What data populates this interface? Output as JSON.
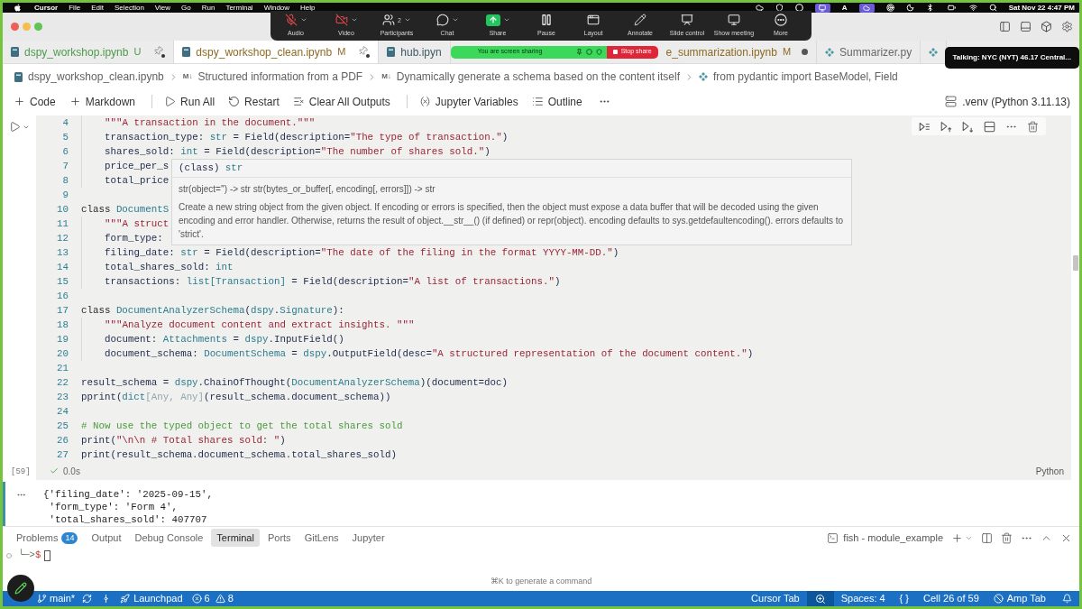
{
  "menu_bar": {
    "app": "Cursor",
    "menus": [
      "File",
      "Edit",
      "Selection",
      "View",
      "Go",
      "Run",
      "Terminal",
      "Window",
      "Help"
    ],
    "input_source": "A",
    "clock": "Sat Nov 22 4:47 PM"
  },
  "meeting_controls": [
    {
      "kind": "audio",
      "label": "Audio",
      "muted": true,
      "menu": true
    },
    {
      "kind": "video",
      "label": "Video",
      "muted": true,
      "menu": true
    },
    {
      "kind": "participants",
      "label": "Participants",
      "count": "2",
      "menu": true
    },
    {
      "kind": "chat",
      "label": "Chat",
      "menu": true
    },
    {
      "kind": "share",
      "label": "Share",
      "menu": true
    },
    {
      "kind": "pause",
      "label": "Pause",
      "menu": false
    },
    {
      "kind": "layout",
      "label": "Layout",
      "menu": false
    },
    {
      "kind": "annotate",
      "label": "Annotate",
      "menu": false
    },
    {
      "kind": "slides",
      "label": "Slide control",
      "menu": false
    },
    {
      "kind": "meeting",
      "label": "Show meeting",
      "menu": false
    },
    {
      "kind": "more",
      "label": "More",
      "menu": false
    }
  ],
  "sharing_banner": {
    "text": "You are screen sharing",
    "stop_label": "Stop share"
  },
  "speaker_notice": "Talking: NYC (NYT) 46.17 Central...",
  "tabs": [
    {
      "kind": "notebook",
      "label": "dspy_workshop.ipynb",
      "git": "U",
      "color": "#4d9a4b",
      "pinned": true,
      "dirty": false,
      "selected": false
    },
    {
      "kind": "notebook",
      "label": "dspy_workshop_clean.ipynb",
      "git": "M",
      "color": "#8e6b22",
      "pinned": true,
      "dirty": false,
      "selected": true
    },
    {
      "kind": "notebook",
      "label": "hub.ipyn",
      "color": "#3f5866",
      "pinned": false,
      "dirty": false,
      "selected": false
    },
    {
      "label": "e_summarization.ipynb",
      "git": "M",
      "color": "#8e6b22",
      "pinned": false,
      "dirty": true,
      "selected": false
    },
    {
      "kind": "python",
      "label": "Summarizer.py",
      "color": "#666666",
      "pinned": false,
      "dirty": false,
      "selected": false
    },
    {
      "kind": "python",
      "pinned": false,
      "dirty": false,
      "selected": false
    }
  ],
  "breadcrumb": [
    {
      "kind": "notebook",
      "text": "dspy_workshop_clean.ipynb"
    },
    {
      "kind": "markdown",
      "marker": "M↓",
      "text": "Structured information from a PDF"
    },
    {
      "kind": "markdown",
      "marker": "M↓",
      "text": "Dynamically generate a schema based on the content itself"
    },
    {
      "kind": "code",
      "text": "from pydantic import BaseModel, Field"
    }
  ],
  "notebook_toolbar": {
    "actions": [
      {
        "kind": "add",
        "label": "Code"
      },
      {
        "kind": "add",
        "label": "Markdown"
      },
      {
        "kind": "divider"
      },
      {
        "kind": "run",
        "label": "Run All"
      },
      {
        "kind": "restart",
        "label": "Restart"
      },
      {
        "kind": "clear",
        "label": "Clear All Outputs"
      },
      {
        "kind": "divider"
      },
      {
        "kind": "variables",
        "label": "Jupyter Variables"
      },
      {
        "kind": "outline",
        "label": "Outline"
      },
      {
        "kind": "more"
      }
    ],
    "kernel": ".venv (Python 3.11.13)"
  },
  "cell": {
    "lines": [
      {
        "children": [
          {
            "number": "4",
            "tokens": [
              {
                "kind": "string",
                "text": "\"\"\"A transaction in the document.\"\"\""
              }
            ]
          },
          {
            "number": "5",
            "tokens": [
              {
                "kind": "plain",
                "text": "transaction_type: "
              },
              {
                "kind": "type",
                "text": "str"
              },
              {
                "kind": "plain",
                "text": " = Field(description="
              },
              {
                "kind": "string",
                "text": "\"The type of transaction.\""
              },
              {
                "kind": "plain",
                "text": ")"
              }
            ]
          },
          {
            "number": "6",
            "tokens": [
              {
                "kind": "plain",
                "text": "shares_sold: "
              },
              {
                "kind": "type",
                "text": "int"
              },
              {
                "kind": "plain",
                "text": " = Field(description="
              },
              {
                "kind": "string",
                "text": "\"The number of shares sold.\""
              },
              {
                "kind": "plain",
                "text": ")"
              }
            ]
          },
          {
            "number": "7",
            "tokens": [
              {
                "kind": "plain",
                "text": "price_per_s"
              }
            ]
          },
          {
            "number": "8",
            "tokens": [
              {
                "kind": "plain",
                "text": "total_price"
              }
            ]
          }
        ]
      },
      {
        "number": "9"
      },
      {
        "number": "10",
        "tokens": [
          {
            "kind": "keyword",
            "text": "class "
          },
          {
            "kind": "type",
            "text": "DocumentS"
          }
        ],
        "children": [
          {
            "number": "11",
            "tokens": [
              {
                "kind": "string",
                "text": "\"\"\"A struct"
              }
            ]
          },
          {
            "number": "12",
            "tokens": [
              {
                "kind": "plain",
                "text": "form_type:"
              }
            ]
          },
          {
            "number": "13",
            "tokens": [
              {
                "kind": "plain",
                "text": "filing_date: "
              },
              {
                "kind": "type",
                "text": "str"
              },
              {
                "kind": "plain",
                "text": " = Field(description="
              },
              {
                "kind": "string",
                "text": "\"The date of the filing in the format YYYY-MM-DD.\""
              },
              {
                "kind": "plain",
                "text": ")"
              }
            ]
          },
          {
            "number": "14",
            "tokens": [
              {
                "kind": "plain",
                "text": "total_shares_sold: "
              },
              {
                "kind": "type",
                "text": "int"
              }
            ]
          },
          {
            "number": "15",
            "tokens": [
              {
                "kind": "plain",
                "text": "transactions: "
              },
              {
                "kind": "type",
                "text": "list[Transaction]"
              },
              {
                "kind": "plain",
                "text": " = Field(description="
              },
              {
                "kind": "string",
                "text": "\"A list of transactions.\""
              },
              {
                "kind": "plain",
                "text": ")"
              }
            ]
          }
        ]
      },
      {
        "number": "16"
      },
      {
        "number": "17",
        "tokens": [
          {
            "kind": "keyword",
            "text": "class "
          },
          {
            "kind": "type",
            "text": "DocumentAnalyzerSchema"
          },
          {
            "kind": "plain",
            "text": "("
          },
          {
            "kind": "type",
            "text": "dspy"
          },
          {
            "kind": "plain",
            "text": "."
          },
          {
            "kind": "type",
            "text": "Signature"
          },
          {
            "kind": "plain",
            "text": "):"
          }
        ],
        "children": [
          {
            "number": "18",
            "tokens": [
              {
                "kind": "string",
                "text": "\"\"\"Analyze document content and extract insights. \"\"\""
              }
            ]
          },
          {
            "number": "19",
            "tokens": [
              {
                "kind": "plain",
                "text": "document: "
              },
              {
                "kind": "type",
                "text": "Attachments"
              },
              {
                "kind": "plain",
                "text": " = "
              },
              {
                "kind": "type",
                "text": "dspy"
              },
              {
                "kind": "plain",
                "text": ".InputField()"
              }
            ]
          },
          {
            "number": "20",
            "tokens": [
              {
                "kind": "plain",
                "text": "document_schema: "
              },
              {
                "kind": "type",
                "text": "DocumentSchema"
              },
              {
                "kind": "plain",
                "text": " = "
              },
              {
                "kind": "type",
                "text": "dspy"
              },
              {
                "kind": "plain",
                "text": ".OutputField(desc="
              },
              {
                "kind": "string",
                "text": "\"A structured representation of the document content.\""
              },
              {
                "kind": "plain",
                "text": ")"
              }
            ]
          }
        ]
      },
      {
        "number": "21"
      },
      {
        "number": "22",
        "tokens": [
          {
            "kind": "plain",
            "text": "result_schema = "
          },
          {
            "kind": "type",
            "text": "dspy"
          },
          {
            "kind": "plain",
            "text": ".ChainOfThought("
          },
          {
            "kind": "type",
            "text": "DocumentAnalyzerSchema"
          },
          {
            "kind": "plain",
            "text": ")(document=doc)"
          }
        ]
      },
      {
        "number": "23",
        "tokens": [
          {
            "kind": "plain",
            "text": "pprint("
          },
          {
            "kind": "type",
            "text": "dict"
          },
          {
            "kind": "dim",
            "text": "[Any, Any]"
          },
          {
            "kind": "plain",
            "text": "(result_schema.document_schema))"
          }
        ]
      },
      {
        "number": "24"
      },
      {
        "number": "25",
        "tokens": [
          {
            "kind": "comment",
            "text": "# Now use the typed object to get the total shares sold"
          }
        ]
      },
      {
        "number": "26",
        "tokens": [
          {
            "kind": "plain",
            "text": "print("
          },
          {
            "kind": "string",
            "text": "\"\\n\\n # Total shares sold: \""
          },
          {
            "kind": "plain",
            "text": ")"
          }
        ]
      },
      {
        "number": "27",
        "tokens": [
          {
            "kind": "plain",
            "text": "print(result_schema.document_schema.total_shares_sold)"
          }
        ]
      }
    ],
    "execution_count": "[59]",
    "succeeded": true,
    "duration": "0.0s",
    "language": "Python"
  },
  "hover_card": {
    "kind_label": "(class)",
    "name": "str",
    "signature": "str(object='') -> str str(bytes_or_buffer[, encoding[, errors]]) -> str",
    "doc": "Create a new string object from the given object. If encoding or errors is specified, then the object must expose a data buffer that will be decoded using the given encoding and error handler. Otherwise, returns the result of object.__str__() (if defined) or repr(object). encoding defaults to sys.getdefaultencoding(). errors defaults to 'strict'."
  },
  "output": {
    "lines": [
      "{'filing_date': '2025-09-15',",
      " 'form_type': 'Form 4',",
      " 'total_shares_sold': 407707"
    ]
  },
  "panel": {
    "tabs": [
      {
        "label": "Problems",
        "badge": "14",
        "selected": false
      },
      {
        "label": "Output",
        "selected": false
      },
      {
        "label": "Debug Console",
        "selected": false
      },
      {
        "label": "Terminal",
        "selected": true
      },
      {
        "label": "Ports",
        "selected": false
      },
      {
        "label": "GitLens",
        "selected": false
      },
      {
        "label": "Jupyter",
        "selected": false
      }
    ],
    "terminal_name": "fish - module_example",
    "prompt": "╰─>",
    "prompt_symbol": "$",
    "hint": "⌘K to generate a command"
  },
  "status_bar": {
    "left": [
      {
        "kind": "branch",
        "text": "main*"
      },
      {
        "kind": "sync"
      },
      {
        "kind": "graph"
      },
      {
        "kind": "launchpad",
        "text": "Launchpad"
      },
      {
        "kind": "problems",
        "errors": "6",
        "warnings": "8"
      }
    ],
    "right": [
      {
        "kind": "text",
        "text": "Cursor Tab"
      },
      {
        "kind": "search"
      },
      {
        "kind": "text",
        "text": "Spaces: 4"
      },
      {
        "kind": "text",
        "text": "{ }"
      },
      {
        "kind": "text",
        "text": "Cell 26 of 59"
      },
      {
        "kind": "amp",
        "text": "Amp Tab"
      },
      {
        "kind": "bell"
      }
    ]
  }
}
